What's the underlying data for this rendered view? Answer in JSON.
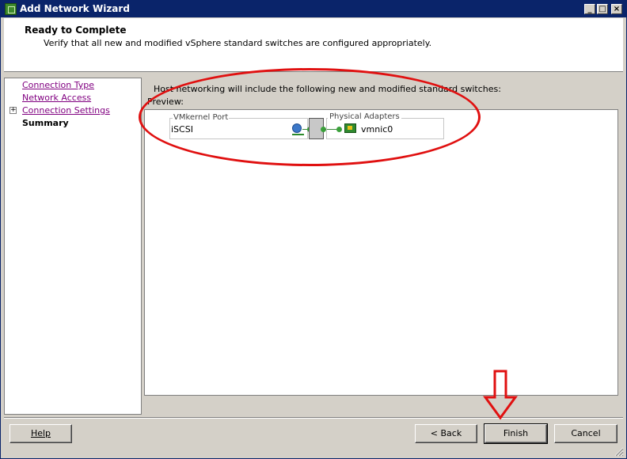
{
  "window": {
    "title": "Add Network Wizard",
    "app_icon": "vsphere-icon",
    "controls": [
      "_",
      "□",
      "×"
    ]
  },
  "header": {
    "title": "Ready to Complete",
    "subtitle": "Verify that all new and modified vSphere standard switches are configured appropriately."
  },
  "nav": {
    "items": [
      {
        "label": "Connection Type",
        "state": "visited"
      },
      {
        "label": "Network Access",
        "state": "visited"
      },
      {
        "label": "Connection Settings",
        "state": "visited",
        "expandable": true,
        "expander": "+"
      },
      {
        "label": "Summary",
        "state": "current"
      }
    ]
  },
  "content": {
    "caption": "Host networking will include the following new and modified standard switches:",
    "preview_label": "Preview:",
    "vmkernel": {
      "legend": "VMkernel Port",
      "name": "iSCSI",
      "icon": "network-globe-icon"
    },
    "switch_icon": "vswitch-icon",
    "physical": {
      "legend": "Physical Adapters",
      "name": "vmnic0",
      "icon": "nic-icon"
    }
  },
  "buttons": {
    "help": "Help",
    "back": "< Back",
    "finish": "Finish",
    "cancel": "Cancel"
  },
  "colors": {
    "titlebar": "#0a246a",
    "link_visited": "#800080",
    "annotation": "#e01010",
    "connector": "#3aa03a",
    "window_bg": "#d4d0c8"
  }
}
